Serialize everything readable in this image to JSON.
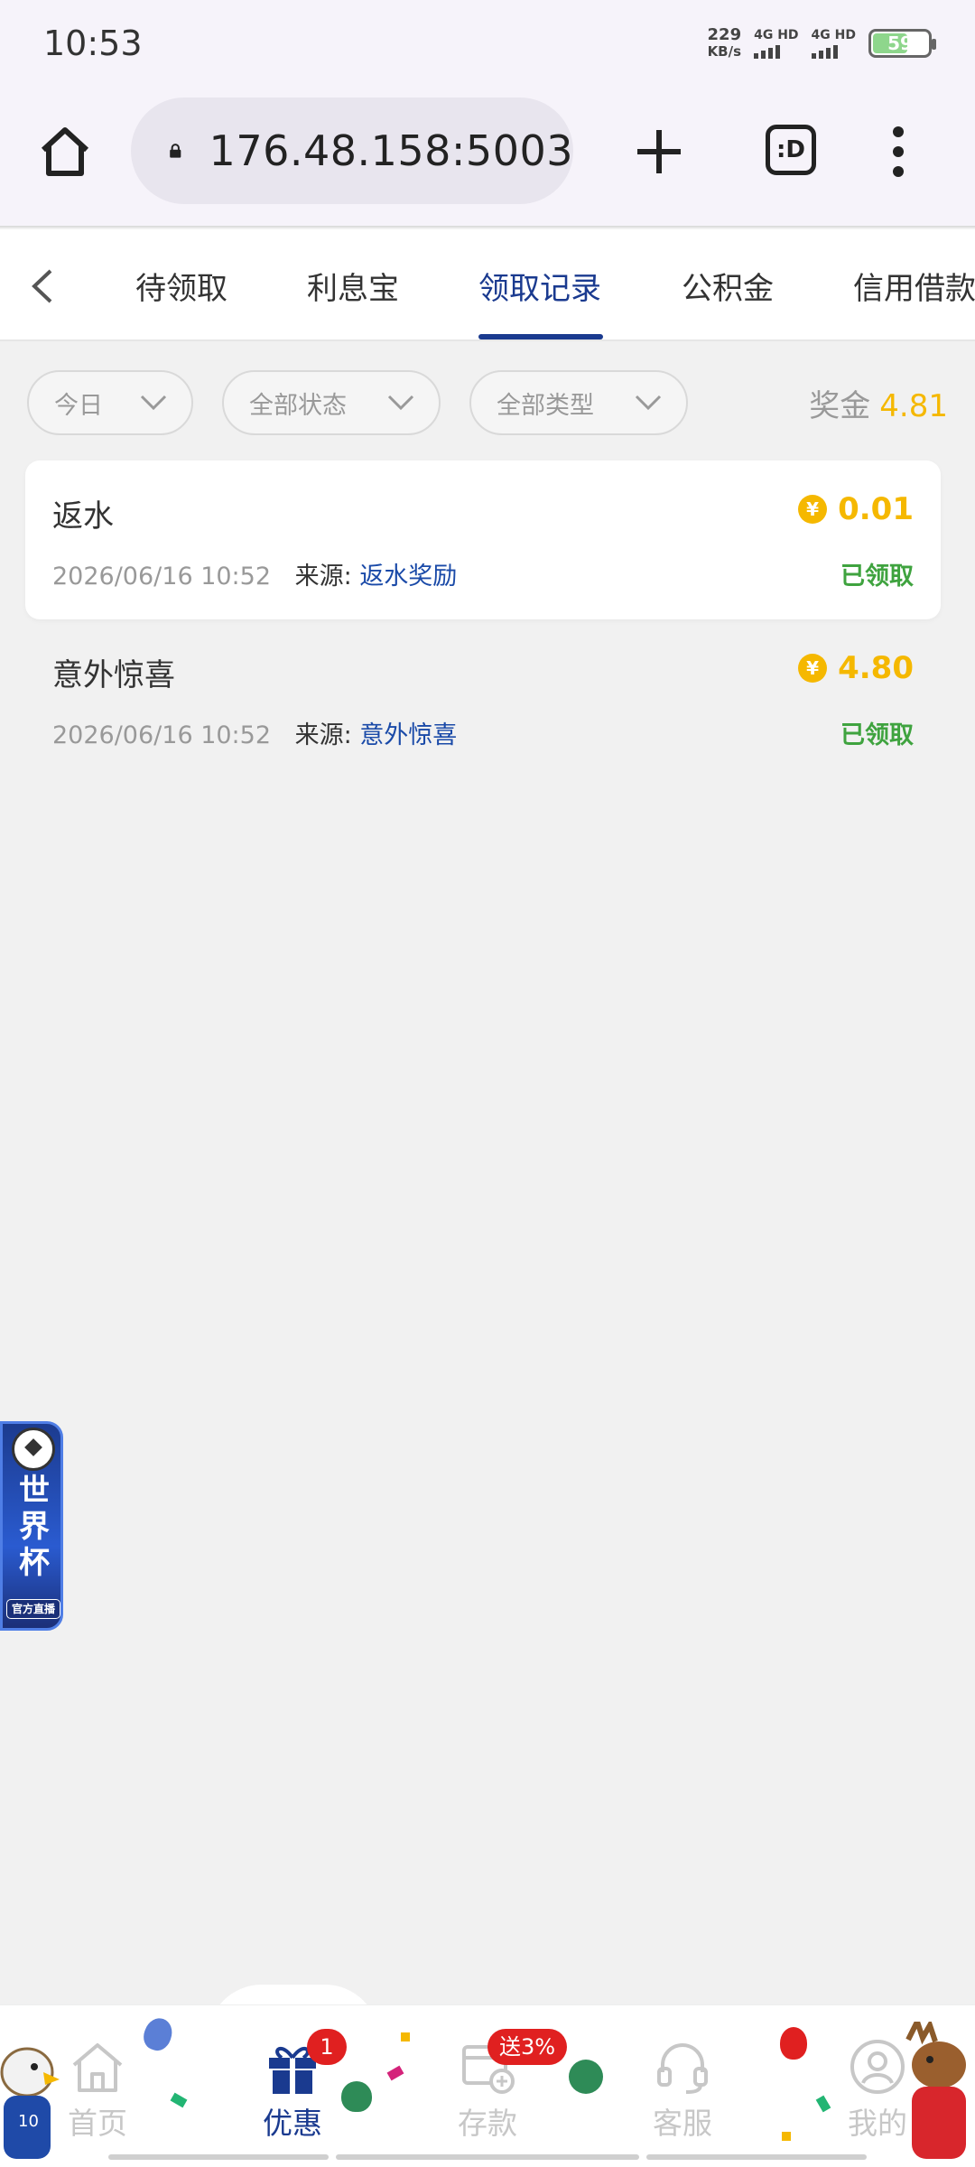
{
  "status_bar": {
    "time": "10:53",
    "net_speed_value": "229",
    "net_speed_unit": "KB/s",
    "signal_1": "4G HD",
    "signal_2": "4G HD",
    "battery_level": "59"
  },
  "browser": {
    "url": "176.48.158:5003",
    "tabs_icon_text": ":D"
  },
  "tabs": [
    {
      "label": "待领取"
    },
    {
      "label": "利息宝"
    },
    {
      "label": "领取记录"
    },
    {
      "label": "公积金"
    },
    {
      "label": "信用借款"
    }
  ],
  "active_tab": "领取记录",
  "filters": {
    "date": "今日",
    "status": "全部状态",
    "type": "全部类型"
  },
  "bonus": {
    "label": "奖金",
    "amount": "4.81"
  },
  "records": [
    {
      "title": "返水",
      "amount": "0.01",
      "datetime": "2026/06/16 10:52",
      "source_label": "来源:",
      "source": "返水奖励",
      "status": "已领取"
    },
    {
      "title": "意外惊喜",
      "amount": "4.80",
      "datetime": "2026/06/16 10:52",
      "source_label": "来源:",
      "source": "意外惊喜",
      "status": "已领取"
    }
  ],
  "world_cup_banner": {
    "title": "世界杯",
    "tag": "官方直播"
  },
  "bottom_nav": [
    {
      "label": "首页",
      "icon": "home-icon"
    },
    {
      "label": "优惠",
      "icon": "gift-icon",
      "badge": "1"
    },
    {
      "label": "存款",
      "icon": "wallet-icon",
      "badge": "送3%"
    },
    {
      "label": "客服",
      "icon": "headset-icon"
    },
    {
      "label": "我的",
      "icon": "profile-icon"
    }
  ],
  "colors": {
    "brand_blue": "#1a3a8f",
    "gold": "#f5b800",
    "success_green": "#3fa33f",
    "badge_red": "#e02020"
  }
}
